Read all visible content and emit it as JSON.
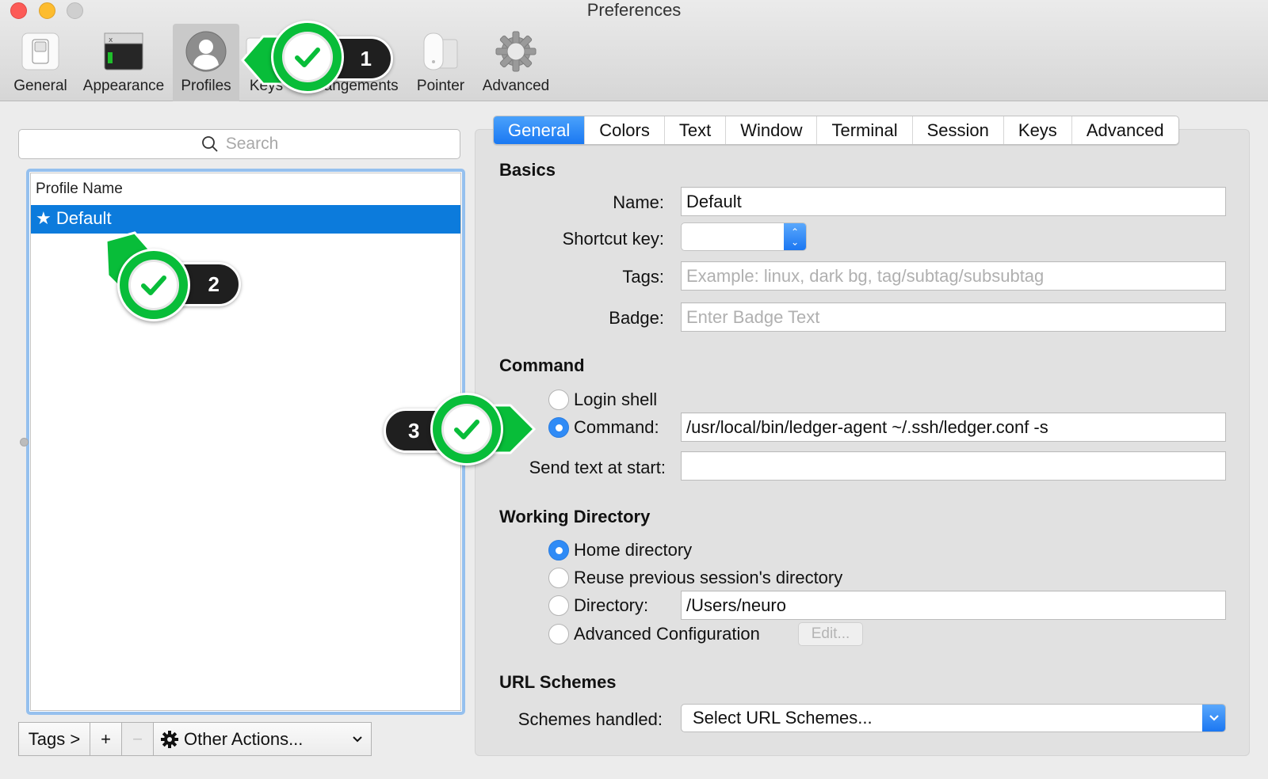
{
  "window": {
    "title": "Preferences",
    "traffic_lights": [
      "close",
      "minimize",
      "zoom"
    ]
  },
  "toolbar": {
    "items": [
      {
        "label": "General",
        "icon": "switch-icon",
        "selected": false
      },
      {
        "label": "Appearance",
        "icon": "terminal-window-icon",
        "selected": false
      },
      {
        "label": "Profiles",
        "icon": "user-silhouette-icon",
        "selected": true
      },
      {
        "label": "Keys",
        "icon": "keyboard-icon",
        "selected": false
      },
      {
        "label": "Arrangements",
        "icon": "window-arrangement-icon",
        "selected": false
      },
      {
        "label": "Pointer",
        "icon": "mouse-icon",
        "selected": false
      },
      {
        "label": "Advanced",
        "icon": "gear-icon",
        "selected": false
      }
    ]
  },
  "profiles": {
    "search_placeholder": "Search",
    "column_header": "Profile Name",
    "rows": [
      {
        "name": "Default",
        "is_default": true,
        "default_marker": "★",
        "selected": true
      }
    ],
    "bottom_bar": {
      "tags_label": "Tags >",
      "add_label": "+",
      "remove_label": "−",
      "other_actions_label": "Other Actions..."
    }
  },
  "tabs": [
    {
      "label": "General",
      "active": true
    },
    {
      "label": "Colors",
      "active": false
    },
    {
      "label": "Text",
      "active": false
    },
    {
      "label": "Window",
      "active": false
    },
    {
      "label": "Terminal",
      "active": false
    },
    {
      "label": "Session",
      "active": false
    },
    {
      "label": "Keys",
      "active": false
    },
    {
      "label": "Advanced",
      "active": false
    }
  ],
  "basics": {
    "title": "Basics",
    "name_label": "Name:",
    "name_value": "Default",
    "shortcut_label": "Shortcut key:",
    "shortcut_value": "",
    "tags_label": "Tags:",
    "tags_placeholder": "Example: linux, dark bg, tag/subtag/subsubtag",
    "badge_label": "Badge:",
    "badge_placeholder": "Enter Badge Text"
  },
  "command": {
    "title": "Command",
    "login_shell_label": "Login shell",
    "command_label": "Command:",
    "command_value": "/usr/local/bin/ledger-agent ~/.ssh/ledger.conf -s",
    "selected": "Command",
    "send_text_label": "Send text at start:",
    "send_text_value": ""
  },
  "working_directory": {
    "title": "Working Directory",
    "options": [
      {
        "label": "Home directory",
        "selected": true
      },
      {
        "label": "Reuse previous session's directory",
        "selected": false
      },
      {
        "label": "Directory:",
        "selected": false
      },
      {
        "label": "Advanced Configuration",
        "selected": false
      }
    ],
    "directory_value": "/Users/neuro",
    "edit_label": "Edit..."
  },
  "url_schemes": {
    "title": "URL Schemes",
    "label": "Schemes handled:",
    "selected_value": "Select URL Schemes..."
  },
  "annotations": [
    {
      "step": "1",
      "target": "Profiles toolbar item"
    },
    {
      "step": "2",
      "target": "Default profile row"
    },
    {
      "step": "3",
      "target": "Command radio option"
    }
  ],
  "colors": {
    "accent_blue": "#1a78f2",
    "selection_blue": "#0c7bdc",
    "annotation_green": "#08bd39",
    "annotation_dark": "#1f1f1f"
  }
}
